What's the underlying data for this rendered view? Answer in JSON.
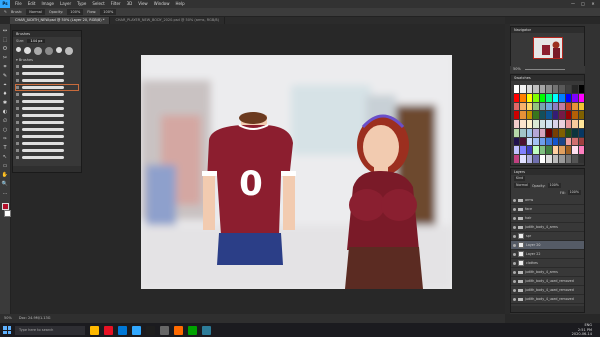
{
  "menu": {
    "app_logo": "Ps",
    "items": [
      "File",
      "Edit",
      "Image",
      "Layer",
      "Type",
      "Select",
      "Filter",
      "3D",
      "View",
      "Window",
      "Help"
    ],
    "window_controls": [
      "—",
      "□",
      "✕"
    ]
  },
  "options_bar": {
    "mode_label": "Brush:",
    "mode_value": "Normal",
    "opacity_label": "Opacity:",
    "opacity_value": "100%",
    "flow_label": "Flow:",
    "flow_value": "100%"
  },
  "tabs": [
    {
      "label": "CHAR_JUDITH_NEW.psd @ 50% (Layer 20, RGB/8) *",
      "active": true
    },
    {
      "label": "CHAR_PLAYER_NEW_BODY_2020.psd @ 50% (arms, RGB/8)",
      "active": false
    }
  ],
  "tools": [
    "↔",
    "⬚",
    "ʘ",
    "✂",
    "⌗",
    "✎",
    "⌖",
    "♦",
    "✱",
    "◐",
    "∅",
    "○",
    "✑",
    "T",
    "↖",
    "▭",
    "✋",
    "🔍",
    "…"
  ],
  "brushes_panel": {
    "title": "Brushes",
    "size_label": "Size:",
    "size_value": "144 px",
    "folder_label": "Brushes",
    "stroke_count": 14,
    "selected_index": 3
  },
  "navigator": {
    "title": "Navigator",
    "zoom_value": "50%"
  },
  "swatches": {
    "title": "Swatches",
    "colors": [
      "#ffffff",
      "#f2f2f2",
      "#d9d9d9",
      "#bfbfbf",
      "#a6a6a6",
      "#8c8c8c",
      "#737373",
      "#595959",
      "#404040",
      "#262626",
      "#000000",
      "#ff0000",
      "#ff8000",
      "#ffff00",
      "#80ff00",
      "#00ff00",
      "#00ff80",
      "#00ffff",
      "#0080ff",
      "#0000ff",
      "#8000ff",
      "#ff00ff",
      "#e06666",
      "#f6b26b",
      "#ffd966",
      "#93c47d",
      "#76a5af",
      "#6fa8dc",
      "#8e7cc3",
      "#c27ba0",
      "#cc4125",
      "#e69138",
      "#f1c232",
      "#cc0000",
      "#e69138",
      "#bf9000",
      "#38761d",
      "#134f5c",
      "#0b5394",
      "#351c75",
      "#741b47",
      "#990000",
      "#b45f06",
      "#7f6000",
      "#f4cccc",
      "#fce5cd",
      "#fff2cc",
      "#d9ead3",
      "#d0e0e3",
      "#cfe2f3",
      "#d9d2e9",
      "#ead1dc",
      "#ea9999",
      "#f9cb9c",
      "#ffe599",
      "#b6d7a8",
      "#a2c4c9",
      "#9fc5e8",
      "#b4a7d6",
      "#d5a6bd",
      "#660000",
      "#783f04",
      "#7f6000",
      "#274e13",
      "#0c343d",
      "#073763",
      "#20124d",
      "#4c1130",
      "#c9daf8",
      "#a4c2f4",
      "#6d9eeb",
      "#3c78d8",
      "#1155cc",
      "#1c4587",
      "#f0a0a0",
      "#d07070",
      "#a04040",
      "#c0c0ff",
      "#8080ff",
      "#4040c0",
      "#c0ffc0",
      "#80c080",
      "#408040",
      "#ffd0a0",
      "#e0a060",
      "#a06020",
      "#ffe0f0",
      "#ff80c0",
      "#c04080",
      "#e0e0ff",
      "#b0b0e0",
      "#7070b0",
      "#ffffff",
      "#dddddd",
      "#bbbbbb",
      "#999999",
      "#777777",
      "#555555",
      "#333333"
    ]
  },
  "layers": {
    "title": "Layers",
    "kind_label": "Kind",
    "blend_mode": "Normal",
    "opacity_label": "Opacity:",
    "opacity_value": "100%",
    "fill_label": "Fill:",
    "fill_value": "100%",
    "items": [
      {
        "name": "arms",
        "type": "folder",
        "selected": false
      },
      {
        "name": "face",
        "type": "folder",
        "selected": false
      },
      {
        "name": "hair",
        "type": "folder",
        "selected": false
      },
      {
        "name": "judith_body_4_arms",
        "type": "folder",
        "selected": false
      },
      {
        "name": "spr",
        "type": "layer",
        "selected": false
      },
      {
        "name": "Layer 20",
        "type": "layer",
        "selected": true
      },
      {
        "name": "Layer 22",
        "type": "layer",
        "selected": false
      },
      {
        "name": "clothes",
        "type": "layer",
        "selected": false
      },
      {
        "name": "judith_body_4_arms",
        "type": "folder",
        "selected": false
      },
      {
        "name": "judith_body_4_used_removed",
        "type": "folder",
        "selected": false
      },
      {
        "name": "judith_body_4_used_removed",
        "type": "folder",
        "selected": false
      },
      {
        "name": "judith_body_4_used_removed",
        "type": "folder",
        "selected": false
      }
    ]
  },
  "status": {
    "zoom": "50%",
    "doc_info": "Doc: 24.9M/1.13G"
  },
  "taskbar": {
    "search_placeholder": "Type here to search",
    "apps": [
      "#ffb900",
      "#e81123",
      "#0078d7",
      "#31a8ff",
      "#1e1e1e",
      "#666666",
      "#ff6a00",
      "#00a300",
      "#2d7d9a"
    ],
    "tray_lang": "ENG",
    "time": "2:51 PM",
    "date": "2020-06-14"
  },
  "canvas": {
    "boy_shirt_number": "0",
    "colors": {
      "background": "#e9e9ea",
      "shirt": "#8c1e2f",
      "sweater": "#7a1a28",
      "skin": "#f2cbb0",
      "hair_brown": "#6b3a1f",
      "hair_red": "#9c2f1f",
      "headband": "#6a4fc9",
      "jeans": "#2b3e87",
      "leggings": "#5b2b22"
    }
  }
}
